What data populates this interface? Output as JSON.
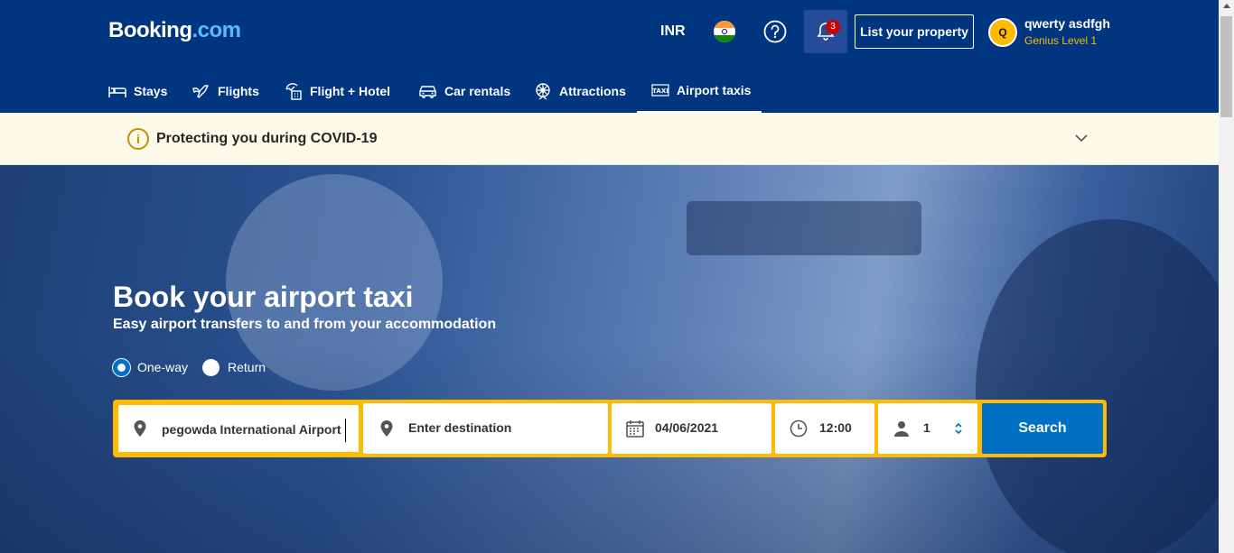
{
  "header": {
    "logo_main": "Booking",
    "logo_dot": ".com",
    "currency": "INR",
    "notification_count": "3",
    "list_property_label": "List your property",
    "user": {
      "initial": "Q",
      "name": "qwerty asdfgh",
      "level": "Genius Level 1"
    }
  },
  "nav": {
    "items": [
      {
        "label": "Stays",
        "icon": "bed-icon"
      },
      {
        "label": "Flights",
        "icon": "plane-icon"
      },
      {
        "label": "Flight + Hotel",
        "icon": "flight-hotel-icon"
      },
      {
        "label": "Car rentals",
        "icon": "car-icon"
      },
      {
        "label": "Attractions",
        "icon": "attractions-icon"
      },
      {
        "label": "Airport taxis",
        "icon": "taxi-icon",
        "active": true
      }
    ]
  },
  "covid": {
    "text": "Protecting you during COVID-19"
  },
  "hero": {
    "title": "Book your airport taxi",
    "subtitle": "Easy airport transfers to and from your accommodation"
  },
  "trip_type": {
    "options": [
      "One-way",
      "Return"
    ],
    "selected": "One-way"
  },
  "search": {
    "pickup_value": "pegowda International Airport",
    "destination_placeholder": "Enter destination",
    "date": "04/06/2021",
    "time": "12:00",
    "passengers": "1",
    "button_label": "Search"
  },
  "colors": {
    "brand_blue": "#003580",
    "accent_yellow": "#febb02",
    "button_blue": "#0071c2"
  }
}
